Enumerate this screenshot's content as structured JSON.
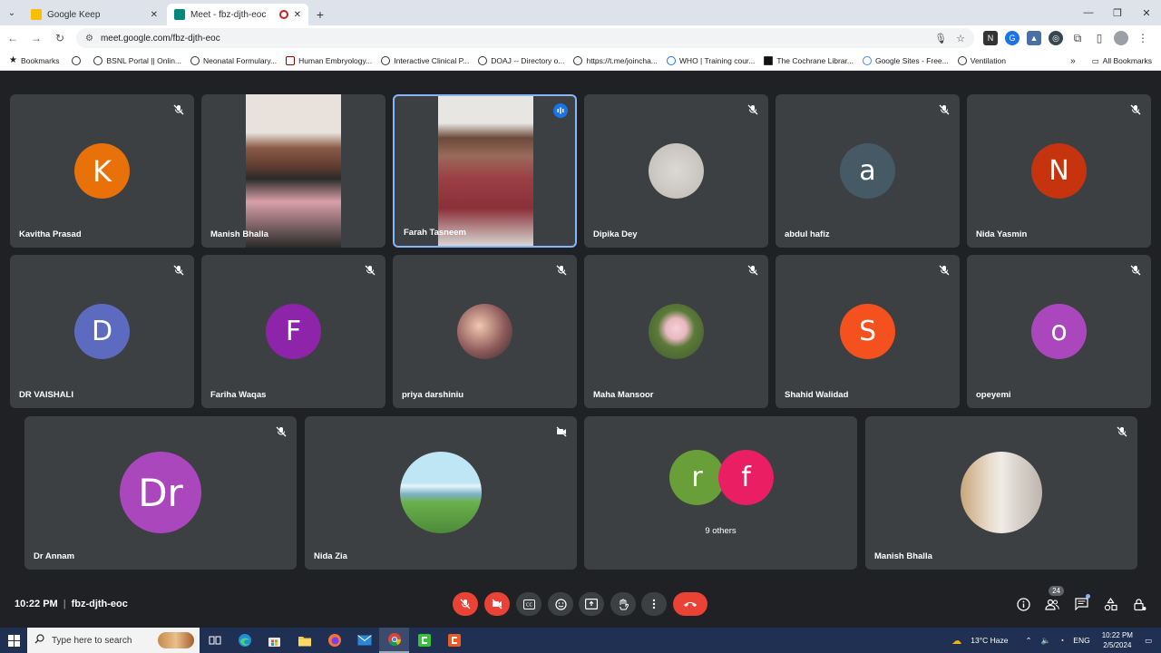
{
  "browser": {
    "tabs": [
      {
        "title": "Google Keep",
        "active": false
      },
      {
        "title": "Meet - fbz-djth-eoc",
        "active": true
      }
    ],
    "url": "meet.google.com/fbz-djth-eoc",
    "bookmarks": [
      "Bookmarks",
      "BSNL Portal || Onlin...",
      "Neonatal Formulary...",
      "Human Embryology...",
      "Interactive Clinical P...",
      "DOAJ -- Directory o...",
      "https://t.me/joincha...",
      "WHO | Training cour...",
      "The Cochrane Librar...",
      "Google Sites - Free...",
      "Ventilation"
    ],
    "all_bookmarks": "All Bookmarks"
  },
  "participants": [
    {
      "name": "Kavitha Prasad",
      "initial": "K",
      "color": "#e8710a"
    },
    {
      "name": "Manish Bhalla",
      "initial": "",
      "color": "#7a4a3a"
    },
    {
      "name": "Farah Tasneem",
      "initial": "",
      "color": "#a05050"
    },
    {
      "name": "Dipika Dey",
      "initial": "",
      "color": "#d0cdc8"
    },
    {
      "name": "abdul hafiz",
      "initial": "a",
      "color": "#455a64"
    },
    {
      "name": "Nida Yasmin",
      "initial": "N",
      "color": "#c5340f"
    },
    {
      "name": "DR VAISHALI",
      "initial": "D",
      "color": "#5c6bc0"
    },
    {
      "name": "Fariha Waqas",
      "initial": "F",
      "color": "#8e24aa"
    },
    {
      "name": "priya darshiniu",
      "initial": "",
      "color": "#8d5a5a"
    },
    {
      "name": "Maha Mansoor",
      "initial": "",
      "color": "#5d7a3a"
    },
    {
      "name": "Shahid Walidad",
      "initial": "S",
      "color": "#f4511e"
    },
    {
      "name": "opeyemi",
      "initial": "o",
      "color": "#ab47bc"
    },
    {
      "name": "Dr Annam",
      "initial": "Dr",
      "color": "#ab47bc"
    },
    {
      "name": "Nida Zia",
      "initial": "",
      "color": "#6ab04c"
    },
    {
      "name": "Manish Bhalla",
      "initial": "",
      "color": "#c9b9a4"
    }
  ],
  "others": {
    "initials": [
      "r",
      "f"
    ],
    "colors": [
      "#689f38",
      "#e91e63"
    ],
    "label": "9 others"
  },
  "meeting": {
    "time": "10:22 PM",
    "code": "fbz-djth-eoc",
    "people_count": "24"
  },
  "taskbar": {
    "search_placeholder": "Type here to search",
    "weather": "13°C  Haze",
    "lang": "ENG",
    "time": "10:22 PM",
    "date": "2/5/2024"
  }
}
